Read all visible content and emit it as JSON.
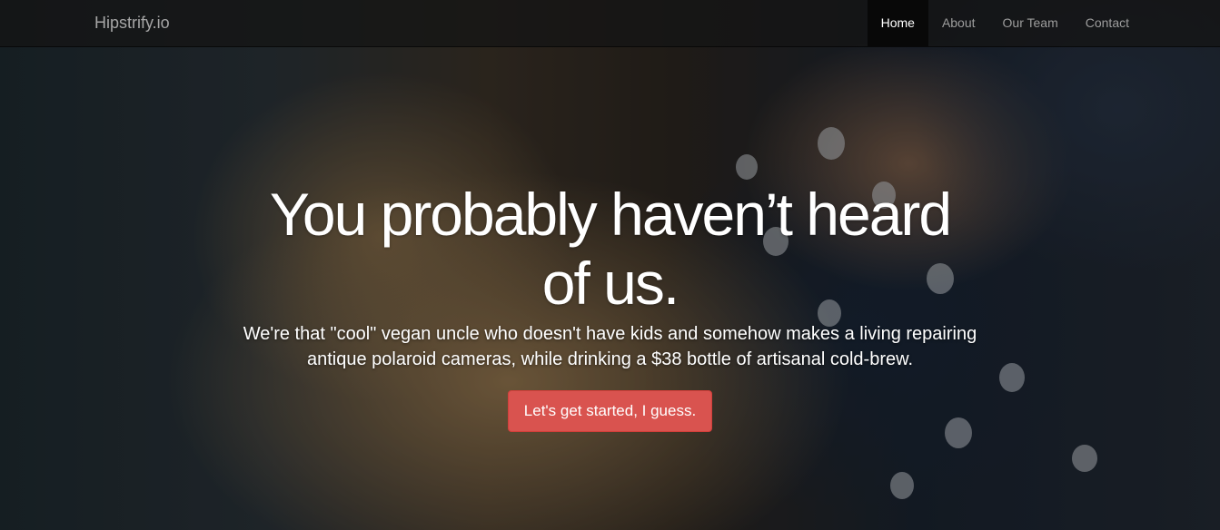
{
  "navbar": {
    "brand": "Hipstrify.io",
    "items": [
      {
        "label": "Home",
        "active": true
      },
      {
        "label": "About",
        "active": false
      },
      {
        "label": "Our Team",
        "active": false
      },
      {
        "label": "Contact",
        "active": false
      }
    ]
  },
  "hero": {
    "headline": "You probably haven’t heard of us.",
    "subtext": "We're that \"cool\" vegan uncle who doesn't have kids and somehow makes a living repairing antique polaroid cameras, while drinking a $38 bottle of artisanal cold-brew.",
    "cta_label": "Let's get started, I guess."
  },
  "colors": {
    "navbar_bg": "#141414",
    "active_nav_bg": "#080808",
    "cta_bg": "#d9534f"
  }
}
